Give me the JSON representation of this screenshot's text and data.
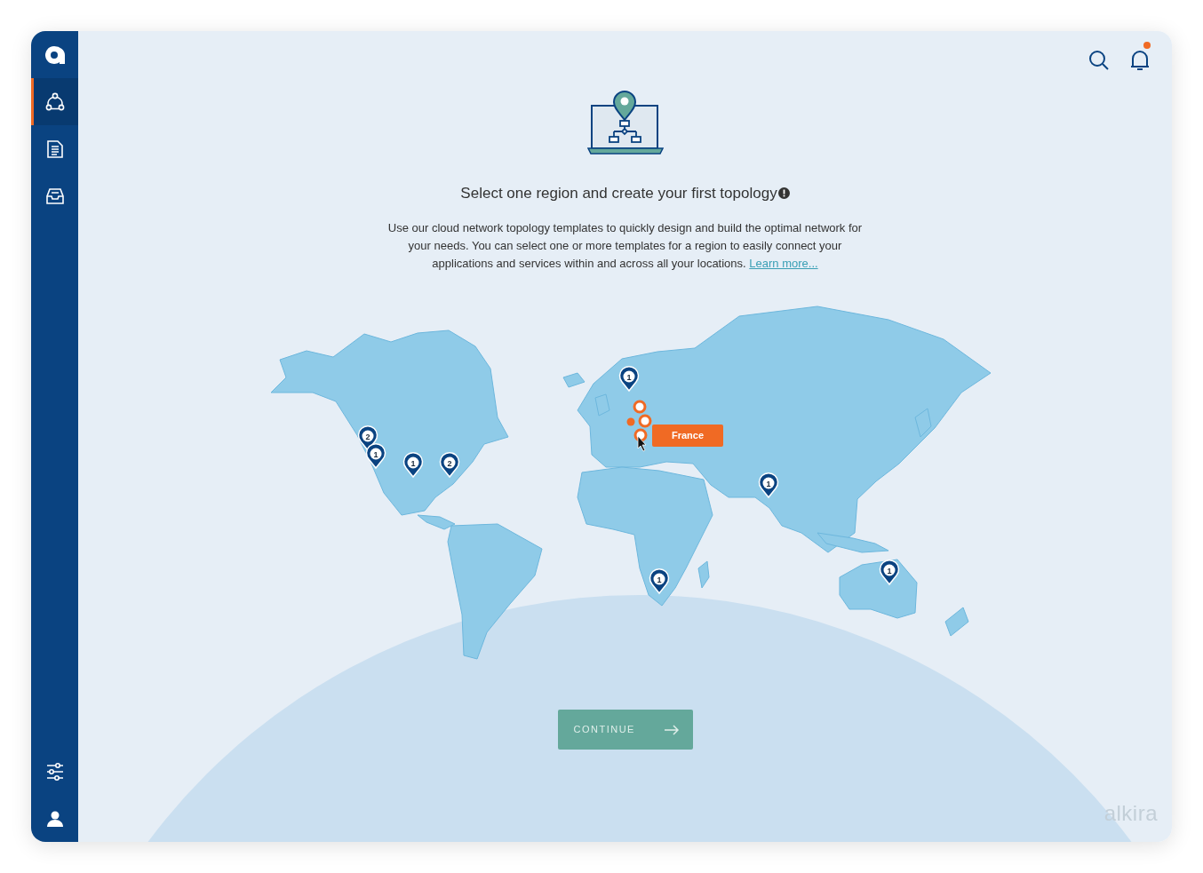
{
  "sidebar": {
    "items": [
      {
        "kind": "topology",
        "selected": true
      },
      {
        "kind": "document",
        "selected": false
      },
      {
        "kind": "inbox",
        "selected": false
      }
    ],
    "bottom_items": [
      {
        "kind": "sliders"
      },
      {
        "kind": "user"
      }
    ]
  },
  "header": {
    "has_notification": true
  },
  "intro": {
    "title": "Select one region and create your first topology",
    "text": "Use our cloud network topology templates to quickly design and build the optimal network for your needs. You can select one or more templates for a region to easily connect your applications and services within and across all your locations.",
    "link": "Learn more..."
  },
  "map": {
    "markers": [
      {
        "kind": "pin",
        "count": "2"
      },
      {
        "kind": "pin",
        "count": "1"
      },
      {
        "kind": "pin",
        "count": "1"
      },
      {
        "kind": "pin",
        "count": "2"
      },
      {
        "kind": "pin",
        "count": "1"
      },
      {
        "kind": "pin",
        "count": "1"
      },
      {
        "kind": "pin",
        "count": "1"
      },
      {
        "kind": "pin",
        "count": "1"
      },
      {
        "kind": "ring"
      },
      {
        "kind": "ring"
      },
      {
        "kind": "dot"
      },
      {
        "kind": "ring"
      }
    ],
    "tooltip": "France"
  },
  "continue_button": "CONTINUE",
  "brand_mark": "alkira"
}
